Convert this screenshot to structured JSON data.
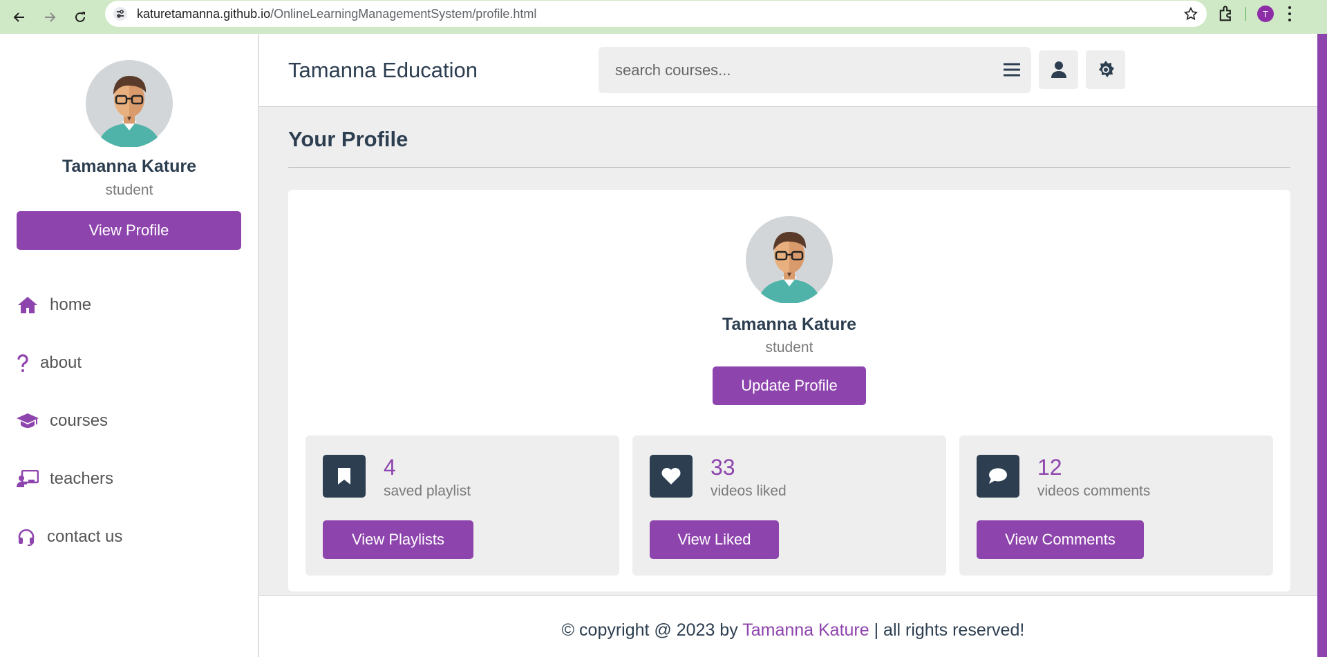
{
  "browser": {
    "url_host": "katuretamanna.github.io",
    "url_path": "/OnlineLearningManagementSystem/profile.html",
    "profile_initial": "T"
  },
  "colors": {
    "accent": "#8e44ad",
    "dark": "#2c3e50",
    "muted": "#7a7a7a",
    "background": "#eeeeee"
  },
  "header": {
    "brand": "Tamanna Education",
    "search_placeholder": "search courses...",
    "buttons": [
      "menu-icon",
      "user-icon",
      "gear-icon"
    ]
  },
  "sidebar": {
    "name": "Tamanna Kature",
    "role": "student",
    "view_profile_label": "View Profile",
    "nav": [
      {
        "label": "home",
        "icon": "home-icon"
      },
      {
        "label": "about",
        "icon": "question-icon"
      },
      {
        "label": "courses",
        "icon": "graduation-cap-icon"
      },
      {
        "label": "teachers",
        "icon": "teacher-icon"
      },
      {
        "label": "contact us",
        "icon": "headset-icon"
      }
    ]
  },
  "main": {
    "title": "Your Profile",
    "profile": {
      "name": "Tamanna Kature",
      "role": "student",
      "update_label": "Update Profile"
    },
    "stats": [
      {
        "count": "4",
        "label": "saved playlist",
        "button": "View Playlists",
        "icon": "bookmark-icon"
      },
      {
        "count": "33",
        "label": "videos liked",
        "button": "View Liked",
        "icon": "heart-icon"
      },
      {
        "count": "12",
        "label": "videos comments",
        "button": "View Comments",
        "icon": "comment-icon"
      }
    ]
  },
  "footer": {
    "prefix": "© copyright @ 2023 by ",
    "author": "Tamanna Kature",
    "suffix": " | all rights reserved!"
  }
}
